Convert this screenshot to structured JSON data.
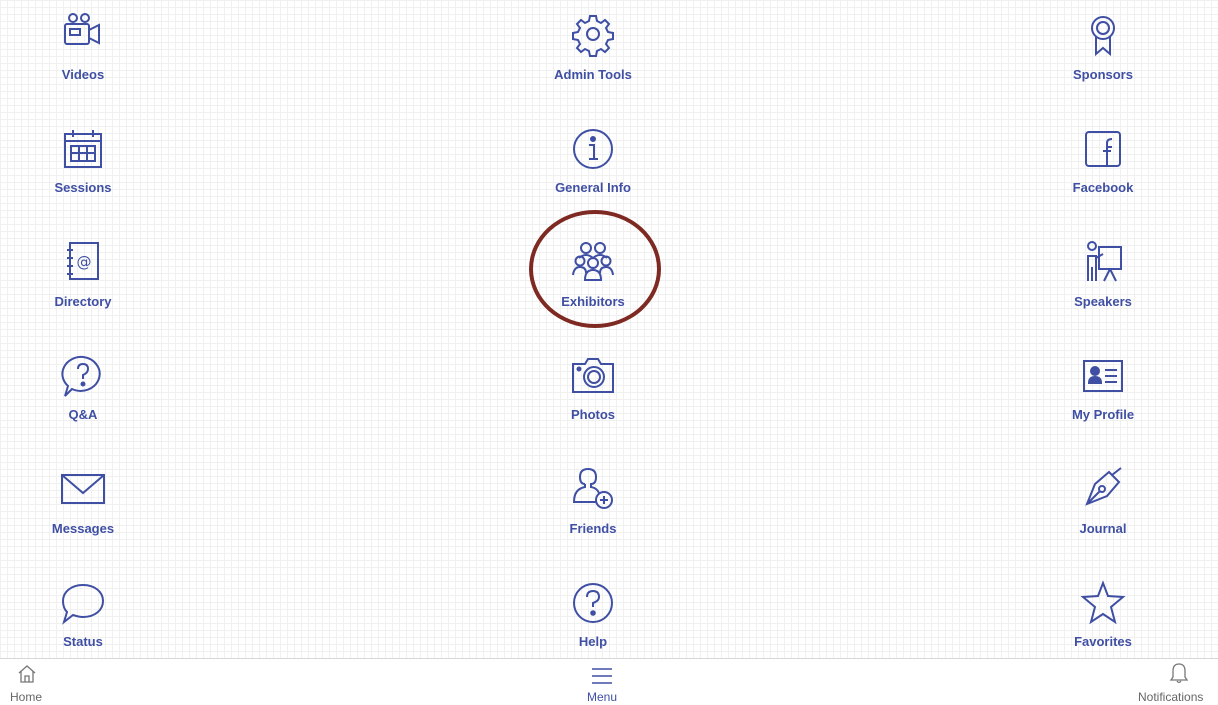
{
  "tiles": [
    {
      "label": "Videos",
      "icon": "video-camera-icon"
    },
    {
      "label": "Admin Tools",
      "icon": "gear-icon"
    },
    {
      "label": "Sponsors",
      "icon": "award-ribbon-icon"
    },
    {
      "label": "Sessions",
      "icon": "calendar-icon"
    },
    {
      "label": "General Info",
      "icon": "info-icon"
    },
    {
      "label": "Facebook",
      "icon": "facebook-icon"
    },
    {
      "label": "Directory",
      "icon": "address-book-icon"
    },
    {
      "label": "Exhibitors",
      "icon": "group-icon"
    },
    {
      "label": "Speakers",
      "icon": "presenter-icon"
    },
    {
      "label": "Q&A",
      "icon": "question-bubble-icon"
    },
    {
      "label": "Photos",
      "icon": "camera-icon"
    },
    {
      "label": "My Profile",
      "icon": "id-card-icon"
    },
    {
      "label": "Messages",
      "icon": "envelope-icon"
    },
    {
      "label": "Friends",
      "icon": "add-friend-icon"
    },
    {
      "label": "Journal",
      "icon": "pen-nib-icon"
    },
    {
      "label": "Status",
      "icon": "speech-bubble-icon"
    },
    {
      "label": "Help",
      "icon": "help-icon"
    },
    {
      "label": "Favorites",
      "icon": "star-icon"
    }
  ],
  "highlighted_tile": "Exhibitors",
  "bottom_nav": {
    "home_label": "Home",
    "menu_label": "Menu",
    "notifications_label": "Notifications"
  },
  "colors": {
    "accent": "#3f4fa3",
    "highlight_ring": "#7e2a22",
    "nav_text": "#666666"
  }
}
